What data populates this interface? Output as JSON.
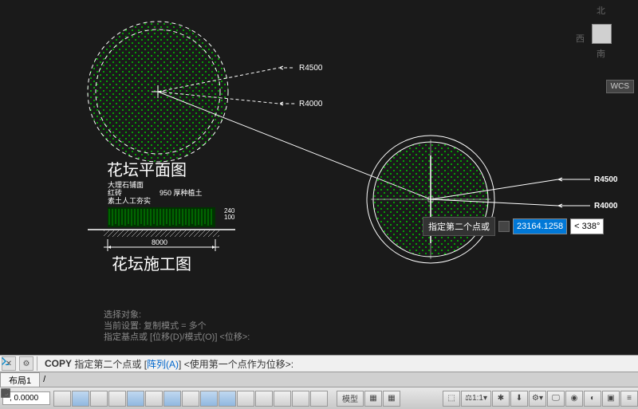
{
  "viewcube": {
    "north": "北",
    "west": "西",
    "south": "南"
  },
  "wcs": "WCS",
  "drawing": {
    "circle1": {
      "r1": "R4500",
      "r2": "R4000",
      "title": "花坛平面图"
    },
    "section": {
      "l1": "大理石铺面",
      "l2": "红砖",
      "l3": "素土人工夯实",
      "l4": "950 厚种植土",
      "d1": "240",
      "d2": "100",
      "dim": "8000",
      "title": "花坛施工图"
    },
    "circle2": {
      "r1": "R4500",
      "r2": "R4000"
    }
  },
  "dyn": {
    "label": "指定第二个点或",
    "value": "23164.1258",
    "angle": "< 338°"
  },
  "info": {
    "l1": "选择对象:",
    "l2": "当前设置:   复制模式 = 多个",
    "l3": "指定基点或 [位移(D)/模式(O)] <位移>:"
  },
  "cmd": {
    "name": "COPY",
    "prompt": "指定第二个点或 [",
    "opt": "阵列(A)",
    "rest": "] <使用第一个点作为位移>:"
  },
  "tab": "布局1",
  "status": {
    "coord": ", 0.0000",
    "model": "模型",
    "scale": "1:1"
  }
}
